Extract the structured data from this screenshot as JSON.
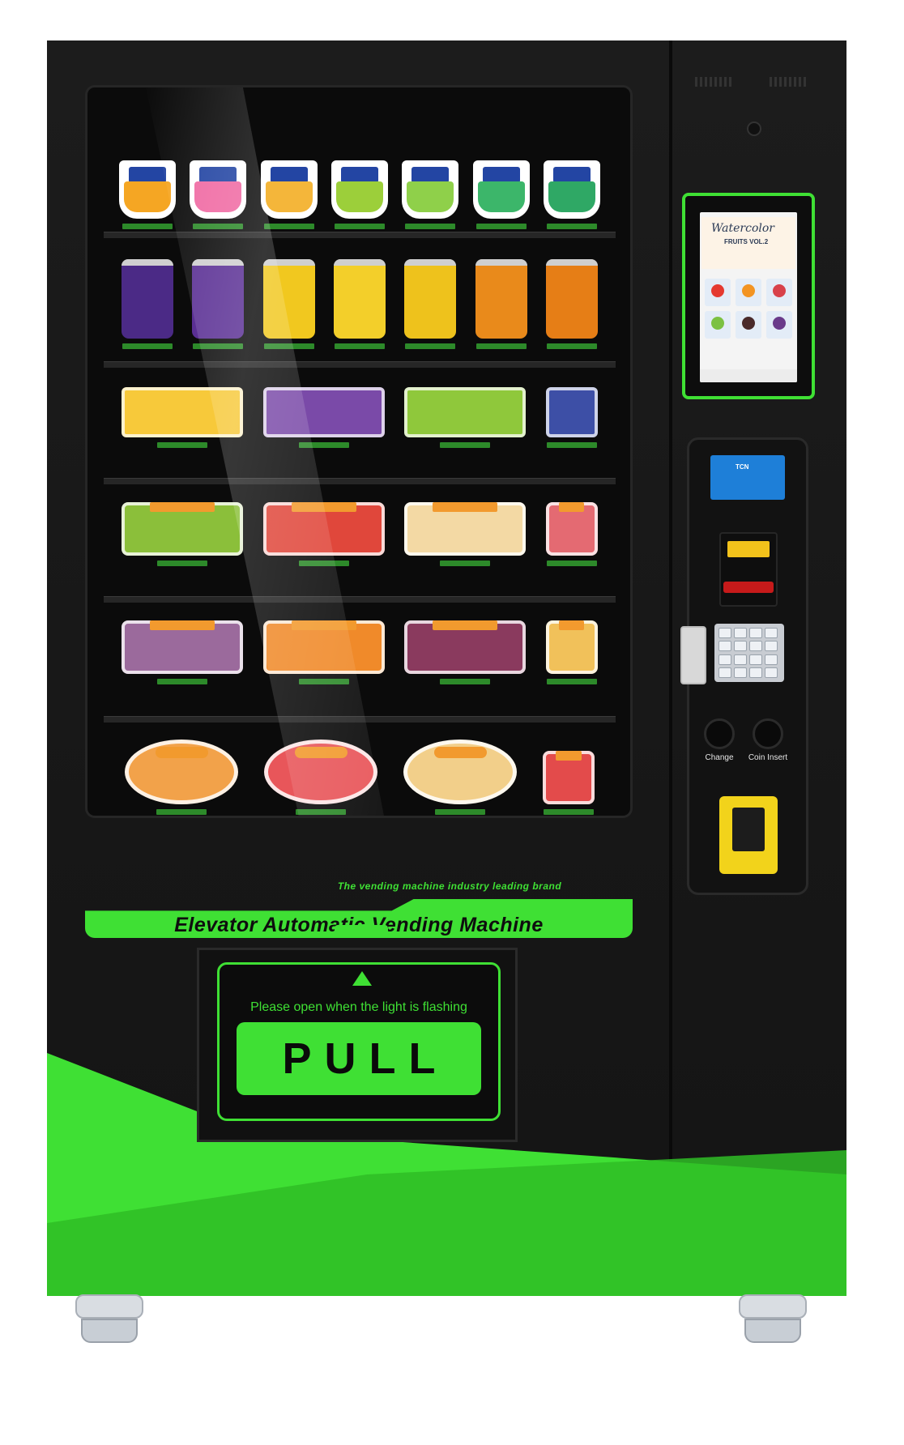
{
  "machine": {
    "slogan": "The vending machine industry leading brand",
    "brand_band": "Elevator Automatic Vending Machine",
    "delivery": {
      "instruction": "Please open when the light is flashing",
      "pull_label": "PULL"
    },
    "touchscreen": {
      "title": "Watercolor",
      "subtitle": "FRUITS VOL.2"
    },
    "card_reader_brand": "TCN",
    "coin": {
      "change_label": "Change",
      "insert_label": "Coin Insert"
    }
  },
  "colors": {
    "accent": "#3fe034",
    "cabinet": "#161616",
    "card_reader": "#1e7fd8",
    "pos": "#f2d31b"
  }
}
